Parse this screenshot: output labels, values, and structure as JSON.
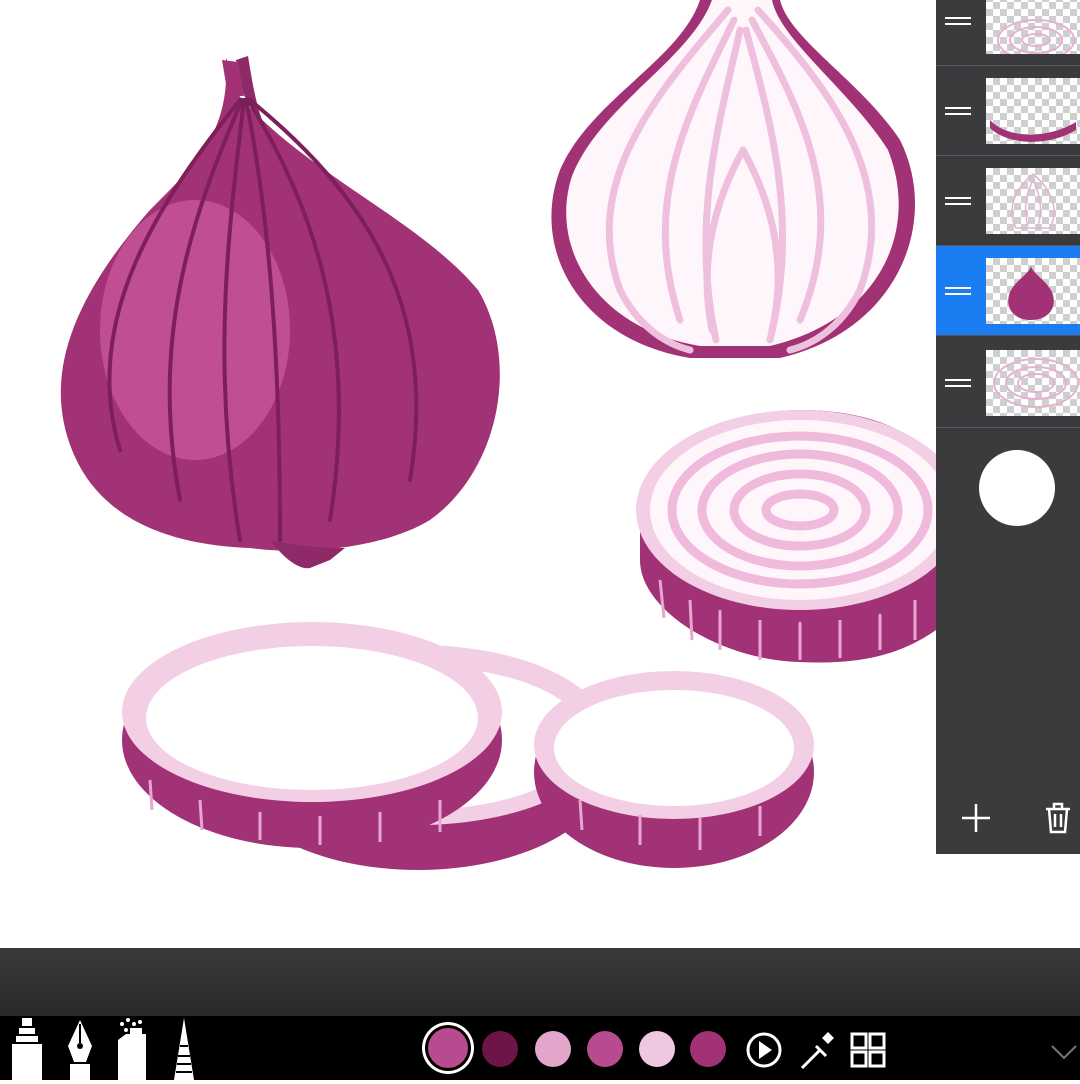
{
  "app": {
    "palette": {
      "colors": [
        {
          "name": "swatch-1",
          "hex": "#b84b8f",
          "active": true
        },
        {
          "name": "swatch-2",
          "hex": "#6e1548"
        },
        {
          "name": "swatch-3",
          "hex": "#e2a6cb"
        },
        {
          "name": "swatch-4",
          "hex": "#b84b8f"
        },
        {
          "name": "swatch-5",
          "hex": "#f0c7e0"
        },
        {
          "name": "swatch-6",
          "hex": "#a13276"
        }
      ]
    },
    "layers": {
      "items": [
        {
          "name": "layer-1",
          "thumbnail": "onion-rings-top",
          "selected": false
        },
        {
          "name": "layer-2",
          "thumbnail": "onion-ring-edges",
          "selected": false
        },
        {
          "name": "layer-3",
          "thumbnail": "onion-half-outline",
          "selected": false
        },
        {
          "name": "layer-4",
          "thumbnail": "whole-onion",
          "selected": true
        },
        {
          "name": "layer-5",
          "thumbnail": "onion-slice-rings",
          "selected": false
        }
      ],
      "current_color_hex": "#ffffff"
    },
    "tools": [
      "marker-icon",
      "pen-nib-icon",
      "spray-can-icon",
      "pencil-icon"
    ],
    "actions": [
      "play-icon",
      "eyedropper-icon",
      "grid-icon",
      "chevron-down-icon"
    ],
    "colors": {
      "onion_dark": "#8e2a68",
      "onion_mid": "#a53a7c",
      "onion_light": "#c65597",
      "onion_pale": "#f3cfe6",
      "onion_white": "#fff6fb",
      "panel_bg": "#3b3b3d",
      "selection": "#1a7ef2"
    }
  }
}
